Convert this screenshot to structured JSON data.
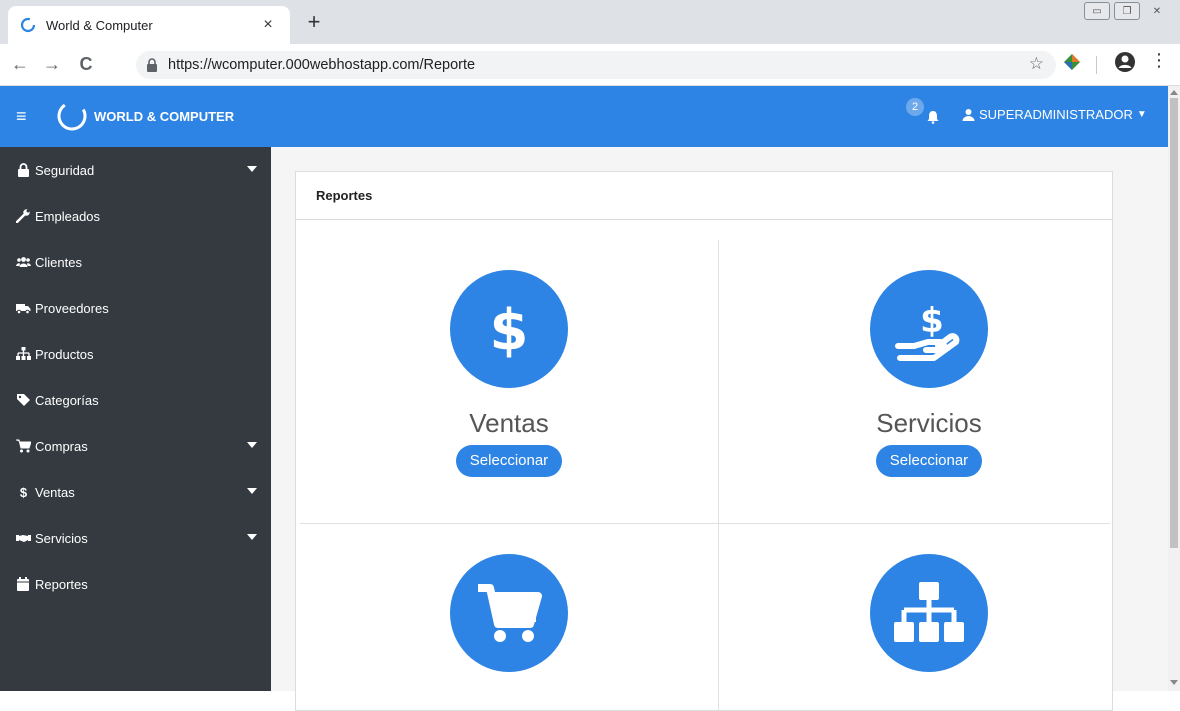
{
  "browser": {
    "tab_title": "World & Computer",
    "tab_close": "×",
    "new_tab": "+",
    "url": "https://wcomputer.000webhostapp.com/Reporte",
    "back": "←",
    "forward": "→",
    "reload": "C",
    "bookmark": "☆",
    "menu": "⋮"
  },
  "navbar": {
    "brand": "WORLD & COMPUTER",
    "notification_count": "2",
    "user": "SUPERADMINISTRADOR",
    "accent": "#2d84e4"
  },
  "sidebar": {
    "items": [
      {
        "label": "Seguridad",
        "icon": "lock-icon",
        "expandable": true
      },
      {
        "label": "Empleados",
        "icon": "wrench-icon",
        "expandable": false
      },
      {
        "label": "Clientes",
        "icon": "users-icon",
        "expandable": false
      },
      {
        "label": "Proveedores",
        "icon": "truck-icon",
        "expandable": false
      },
      {
        "label": "Productos",
        "icon": "sitemap-icon",
        "expandable": false
      },
      {
        "label": "Categorías",
        "icon": "tag-icon",
        "expandable": false
      },
      {
        "label": "Compras",
        "icon": "cart-icon",
        "expandable": true
      },
      {
        "label": "Ventas",
        "icon": "dollar-icon",
        "expandable": true
      },
      {
        "label": "Servicios",
        "icon": "handshake-icon",
        "expandable": true
      },
      {
        "label": "Reportes",
        "icon": "calendar-icon",
        "expandable": false
      }
    ]
  },
  "card": {
    "title": "Reportes",
    "tiles": [
      {
        "title": "Ventas",
        "button": "Seleccionar",
        "icon": "dollar-icon"
      },
      {
        "title": "Servicios",
        "button": "Seleccionar",
        "icon": "hand-dollar-icon"
      },
      {
        "title": "",
        "button": "",
        "icon": "cart-icon"
      },
      {
        "title": "",
        "button": "",
        "icon": "sitemap-icon"
      }
    ]
  }
}
